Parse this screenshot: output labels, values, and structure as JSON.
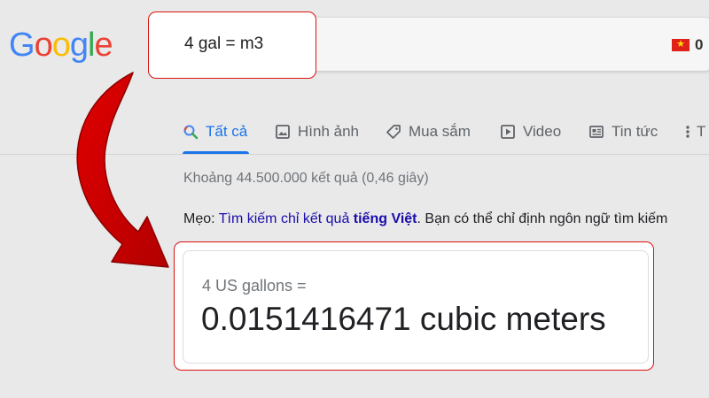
{
  "logo": {
    "letters": [
      {
        "char": "G",
        "color": "#4285f4"
      },
      {
        "char": "o",
        "color": "#ea4335"
      },
      {
        "char": "o",
        "color": "#fbbc05"
      },
      {
        "char": "g",
        "color": "#4285f4"
      },
      {
        "char": "l",
        "color": "#34a853"
      },
      {
        "char": "e",
        "color": "#ea4335"
      }
    ]
  },
  "search": {
    "query": "4 gal = m3"
  },
  "header": {
    "flag_icon": "vietnam-flag-icon",
    "account_count": "0"
  },
  "tabs": [
    {
      "label": "Tất cả",
      "icon": "search-icon",
      "active": true
    },
    {
      "label": "Hình ảnh",
      "icon": "image-icon",
      "active": false
    },
    {
      "label": "Mua sắm",
      "icon": "tag-icon",
      "active": false
    },
    {
      "label": "Video",
      "icon": "play-icon",
      "active": false
    },
    {
      "label": "Tin tức",
      "icon": "news-icon",
      "active": false
    },
    {
      "label": "T",
      "icon": "more-vert-icon",
      "active": false
    }
  ],
  "results": {
    "stats": "Khoảng 44.500.000 kết quả (0,46 giây)",
    "tip_prefix": "Mẹo: ",
    "tip_link": "Tìm kiếm chỉ kết quả ",
    "tip_bold": "tiếng Việt",
    "tip_suffix": ". Bạn có thể chỉ định ngôn ngữ tìm kiếm"
  },
  "answer": {
    "from": "4 US gallons =",
    "result": "0.0151416471 cubic meters"
  },
  "colors": {
    "accent": "#1a73e8",
    "highlight": "#dd1111",
    "link": "#1a0dab"
  }
}
